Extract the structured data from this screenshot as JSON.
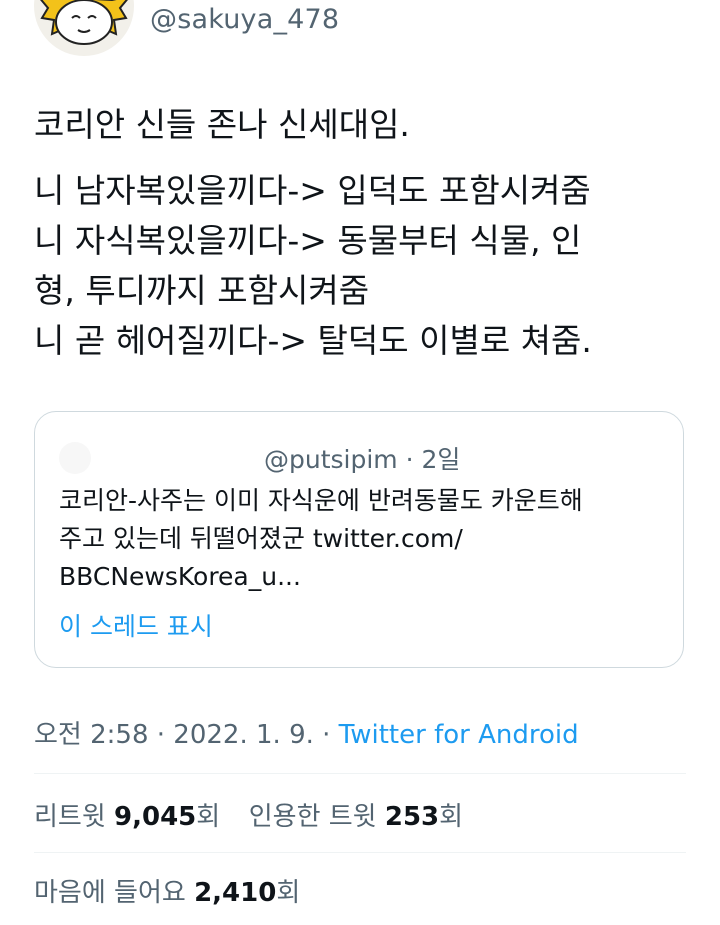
{
  "author": {
    "handle": "@sakuya_478"
  },
  "tweet": {
    "lines": [
      "코리안 신들 존나 신세대임.",
      "",
      "니 남자복있을끼다-> 입덕도 포함시켜줌",
      "니 자식복있을끼다-> 동물부터 식물, 인",
      "형, 투디까지 포함시켜줌",
      "니 곧 헤어질끼다-> 탈덕도 이별로 쳐줌."
    ]
  },
  "quoted_tweet": {
    "handle_time": "@putsipim · 2일",
    "lines": [
      "코리안-사주는 이미 자식운에 반려동물도 카운트해",
      "주고 있는데 뒤떨어졌군 twitter.com/",
      "BBCNewsKorea_u..."
    ],
    "show_thread": "이 스레드 표시"
  },
  "meta": {
    "time": "오전 2:58",
    "separator": " · ",
    "date": "2022. 1. 9.",
    "source": "Twitter for Android"
  },
  "stats": {
    "retweets_label": "리트윗 ",
    "retweets_count": "9,045",
    "retweets_unit": "회",
    "quotes_label": "인용한 트윗 ",
    "quotes_count": "253",
    "quotes_unit": "회",
    "likes_label": "마음에 들어요 ",
    "likes_count": "2,410",
    "likes_unit": "회"
  },
  "colors": {
    "text": "#0f1419",
    "secondary": "#536471",
    "link": "#1d9bf0",
    "border": "#cfd9de"
  }
}
